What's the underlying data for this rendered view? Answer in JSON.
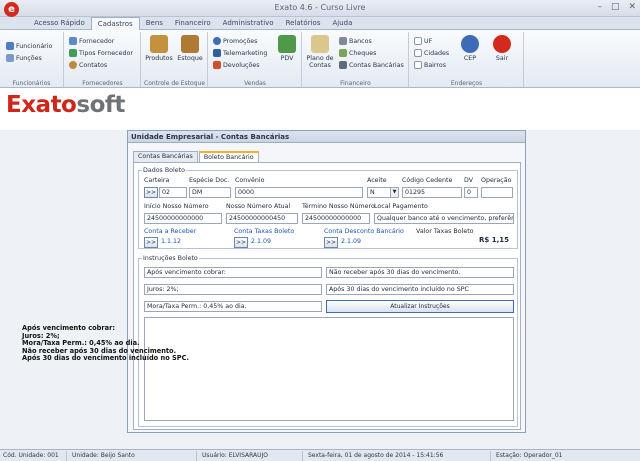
{
  "window": {
    "title": "Exato 4.6 - Curso Livre",
    "min": "–",
    "max": "□",
    "close": "✕"
  },
  "menu": {
    "tabs": [
      "Acesso Rápido",
      "Cadastros",
      "Bens",
      "Financeiro",
      "Administrativo",
      "Relatórios",
      "Ajuda"
    ],
    "active": 1
  },
  "ribbon": {
    "funcionarios": {
      "items": [
        "Funcionário",
        "Funções"
      ],
      "title": "Funcionários"
    },
    "fornecedores": {
      "items": [
        "Fornecedor",
        "Tipos Fornecedor",
        "Contatos"
      ],
      "title": "Fornecedores"
    },
    "estoque": {
      "items": [
        "Produtos",
        "Estoque"
      ],
      "title": "Controle de Estoque"
    },
    "vendas": {
      "items": [
        "Promoções",
        "Telemarketing",
        "Devoluções",
        "PDV"
      ],
      "title": "Vendas"
    },
    "financeiro": {
      "items": [
        "Plano de Contas",
        "Bancos",
        "Cheques",
        "Contas Bancárias"
      ],
      "title": "Financeiro"
    },
    "enderecos": {
      "items": [
        "UF",
        "Cidades",
        "Bairros",
        "CEP",
        "Sair"
      ],
      "title": "Endereços"
    }
  },
  "logo": {
    "part1": "Exato",
    "part2": "soft"
  },
  "panel": {
    "title": "Unidade Empresarial - Contas Bancárias",
    "tabs": [
      "Contas Bancárias",
      "Boleto Bancário"
    ],
    "boleto": {
      "legend": "Dados Boleto",
      "carteira_label": "Carteira",
      "carteira": "02",
      "especie_label": "Espécie Doc.",
      "especie": "DM",
      "convenio_label": "Convênio",
      "convenio": "0000",
      "aceite_label": "Aceite",
      "aceite": "N",
      "cedente_label": "Código Cedente",
      "cedente": "01295",
      "dv_label": "DV",
      "dv": "0",
      "operacao_label": "Operação",
      "operacao": "",
      "inicio_label": "Início Nosso Número",
      "inicio": "24500000000000",
      "atual_label": "Nosso Número Atual",
      "atual": "24500000000450",
      "termino_label": "Término Nosso Número",
      "termino": "24500000000000",
      "local_label": "Local Pagamento",
      "local": "Qualquer banco até o vencimento, preferência",
      "receber_label": "Conta a Receber",
      "receber": "1.1.12",
      "taxas_label": "Conta Taxas Boleto",
      "taxas": "2.1.09",
      "desconto_label": "Conta Desconto Bancário",
      "desconto": "2.1.09",
      "valor_label": "Valor Taxas Boleto",
      "valor": "R$ 1,15",
      "lookup": ">>"
    },
    "instrucoes": {
      "legend": "Instruções Boleto",
      "apos": "Após vencimento cobrar:",
      "nao_receber": "Não receber após 30 dias do vencimento.",
      "juros": "Juros: 2%;",
      "spc": "Após 30 dias do vencimento incluído no SPC",
      "mora": "Mora/Taxa Perm.: 0,45% ao dia.",
      "button": "Atualizar Instruções",
      "text": [
        "Após vencimento cobrar:",
        "Juros: 2%;",
        "Mora/Taxa Perm.: 0,45% ao dia.",
        "Não receber após 30 dias do vencimento.",
        "Após 30 dias do vencimento incluído no SPC."
      ]
    }
  },
  "status": {
    "cod_unidade": "Cód. Unidade: 001",
    "unidade": "Unidade: Beijo Santo",
    "usuario": "Usuário: ELVISARAUJO",
    "data": "Sexta-feira, 01 de agosto de 2014 - 15:41:56",
    "estacao": "Estação: Operador_01"
  }
}
